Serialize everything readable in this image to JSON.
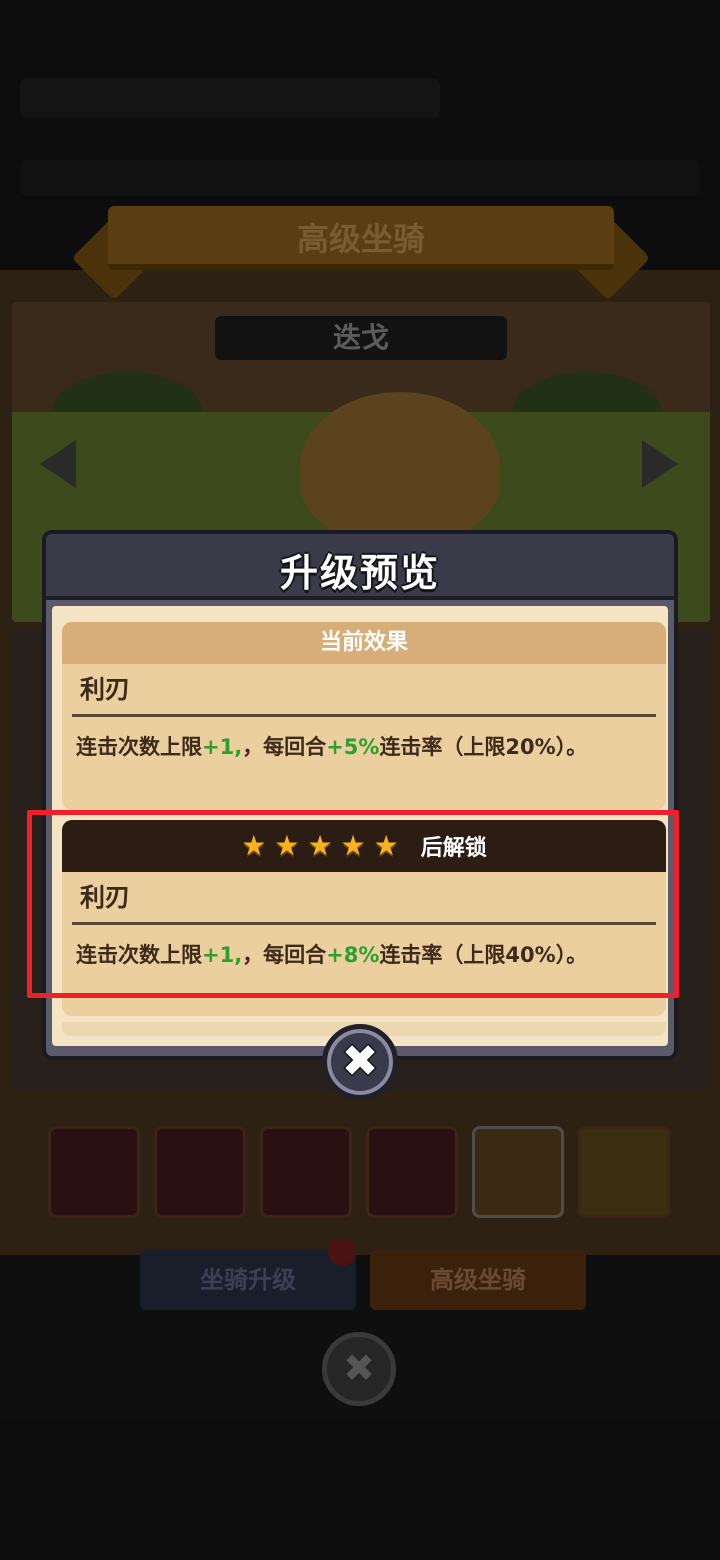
{
  "background": {
    "banner_title": "高级坐骑",
    "mount_name": "迭戈",
    "tabs": [
      "坐骑升级",
      "高级坐骑"
    ]
  },
  "modal": {
    "title": "升级预览",
    "current": {
      "header": "当前效果",
      "skill_name": "利刃",
      "effect_prefix": "连击次数上限",
      "effect_value1": "+1,",
      "effect_mid": "，每回合",
      "effect_value2": "+5%",
      "effect_suffix": "连击率（上限20%）。"
    },
    "next": {
      "stars": 5,
      "header": "后解锁",
      "skill_name": "利刃",
      "effect_prefix": "连击次数上限",
      "effect_value1": "+1,",
      "effect_mid": "，每回合",
      "effect_value2": "+8%",
      "effect_suffix": "连击率（上限40%）。"
    },
    "close_icon": "close-icon"
  },
  "colors": {
    "bonus_green": "#2e9e2e",
    "highlight_red": "#f0202a",
    "star_gold": "#f7b21f"
  }
}
